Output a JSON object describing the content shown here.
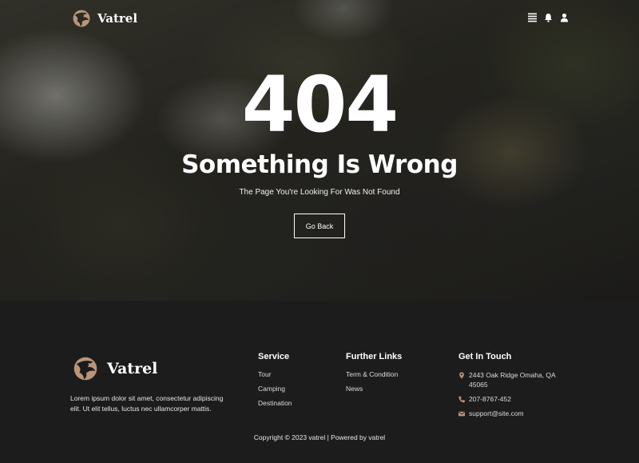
{
  "brand": {
    "name": "Vatrel",
    "accent": "#b9957a"
  },
  "nav": {
    "icons": [
      "menu-icon",
      "bell-icon",
      "user-icon"
    ]
  },
  "error": {
    "code": "404",
    "title": "Something Is Wrong",
    "subtitle": "The Page You're Looking For Was Not Found",
    "button_label": "Go Back"
  },
  "footer": {
    "description": "Lorem ipsum dolor sit amet, consectetur adipiscing elit. Ut elit tellus, luctus nec ullamcorper mattis.",
    "service": {
      "heading": "Service",
      "items": [
        "Tour",
        "Camping",
        "Destination"
      ]
    },
    "further_links": {
      "heading": "Further Links",
      "items": [
        "Term & Condition",
        "News"
      ]
    },
    "contact": {
      "heading": "Get In Touch",
      "address": "2443 Oak Ridge Omaha, QA 45065",
      "phone": "207-8767-452",
      "email": "support@site.com"
    },
    "copyright": "Copyright © 2023 vatrel | Powered by vatrel"
  }
}
